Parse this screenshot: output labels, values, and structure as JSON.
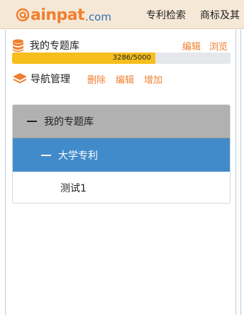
{
  "header": {
    "logo": {
      "brand": "ainpat",
      "tld": ".com"
    },
    "nav": [
      "专利检索",
      "商标及其"
    ]
  },
  "library": {
    "title": "我的专题库",
    "actions": [
      "编辑",
      "浏览"
    ],
    "usage": {
      "text": "3286/5000",
      "used": 3286,
      "total": 5000
    }
  },
  "navigation": {
    "title": "导航管理",
    "actions": [
      "删除",
      "编辑",
      "增加"
    ]
  },
  "tree": {
    "root": "我的专题库",
    "child": "大学专利",
    "leaf": "测试1"
  },
  "colors": {
    "accent": "#f07f2f",
    "selected": "#428bca",
    "progress": "#f6be1c",
    "root_bg": "#b1b1b1"
  },
  "icons": {
    "logo": "at-icon",
    "library": "database-icon",
    "navigation": "layers-icon"
  }
}
